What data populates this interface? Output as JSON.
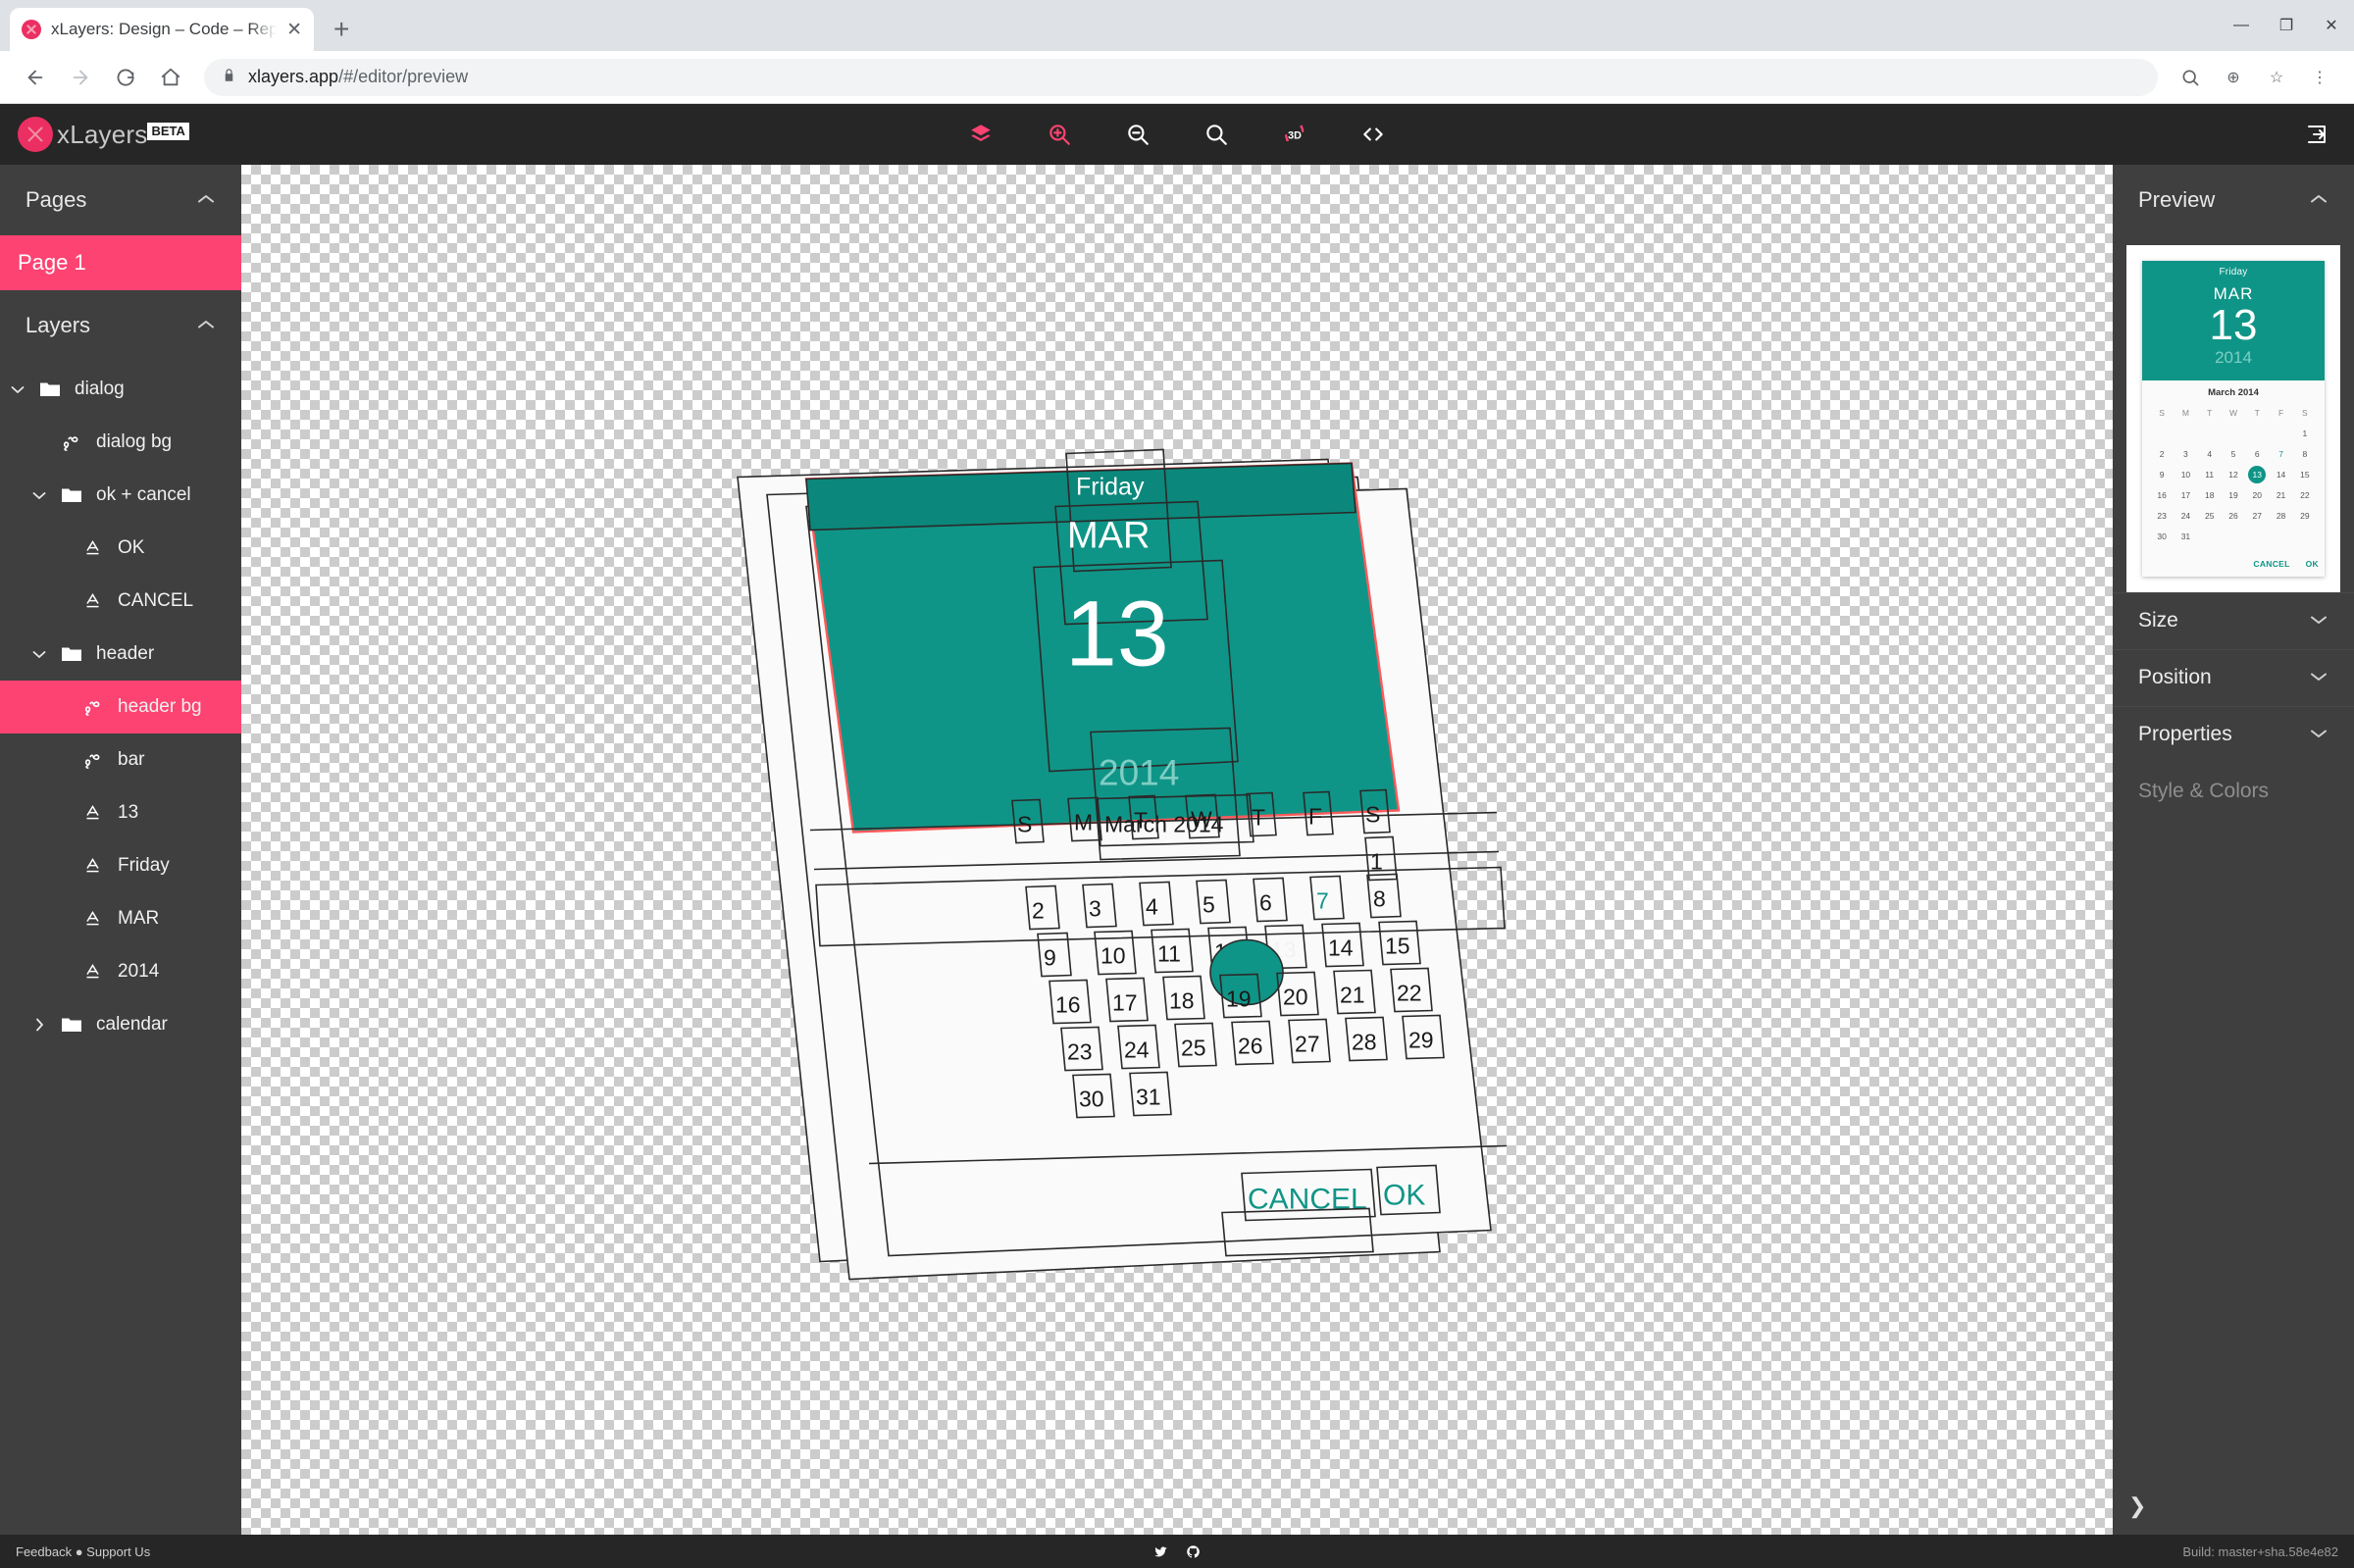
{
  "browser": {
    "tab_title": "xLayers: Design – Code – Repeat",
    "favicon": "xlayers-logo-icon",
    "new_tab_label": "+",
    "close_tab_label": "✕",
    "window_minimize": "—",
    "window_maximize": "❐",
    "window_close": "✕",
    "url_domain": "xlayers.app",
    "url_path": "/#/editor/preview",
    "back_label": "←",
    "forward_label": "→",
    "reload_label": "⟳",
    "home_label": "⌂",
    "lock_label": "🔒",
    "zoom_label": "⊕",
    "bookmark_label": "☆",
    "menu_label": "⋮"
  },
  "app_header": {
    "brand_name": "xLayers",
    "beta_badge": "BETA",
    "tools": [
      {
        "name": "layers-icon",
        "accent": true
      },
      {
        "name": "zoom-in-icon",
        "accent": true
      },
      {
        "name": "zoom-out-icon",
        "accent": false
      },
      {
        "name": "zoom-reset-icon",
        "accent": false
      },
      {
        "name": "rotate-3d-icon",
        "accent": true
      },
      {
        "name": "code-icon",
        "accent": false
      }
    ],
    "login_icon": "login-icon"
  },
  "sidebar": {
    "pages_title": "Pages",
    "pages_collapse": "⌃",
    "pages": [
      {
        "label": "Page 1",
        "selected": true
      }
    ],
    "layers_title": "Layers",
    "layers_collapse": "⌃",
    "layers": [
      {
        "label": "dialog",
        "icon": "folder-icon",
        "indent": 0,
        "arrow": "expanded",
        "selected": false
      },
      {
        "label": "dialog bg",
        "icon": "shape-icon",
        "indent": 1,
        "arrow": "none",
        "selected": false
      },
      {
        "label": "ok + cancel",
        "icon": "folder-icon",
        "indent": 1,
        "arrow": "expanded",
        "selected": false
      },
      {
        "label": "OK",
        "icon": "text-icon",
        "indent": 2,
        "arrow": "none",
        "selected": false
      },
      {
        "label": "CANCEL",
        "icon": "text-icon",
        "indent": 2,
        "arrow": "none",
        "selected": false
      },
      {
        "label": "header",
        "icon": "folder-icon",
        "indent": 1,
        "arrow": "expanded",
        "selected": false
      },
      {
        "label": "header bg",
        "icon": "shape-icon",
        "indent": 2,
        "arrow": "none",
        "selected": true
      },
      {
        "label": "bar",
        "icon": "shape-icon",
        "indent": 2,
        "arrow": "none",
        "selected": false
      },
      {
        "label": "13",
        "icon": "text-icon",
        "indent": 2,
        "arrow": "none",
        "selected": false
      },
      {
        "label": "Friday",
        "icon": "text-icon",
        "indent": 2,
        "arrow": "none",
        "selected": false
      },
      {
        "label": "MAR",
        "icon": "text-icon",
        "indent": 2,
        "arrow": "none",
        "selected": false
      },
      {
        "label": "2014",
        "icon": "text-icon",
        "indent": 2,
        "arrow": "none",
        "selected": false
      },
      {
        "label": "calendar",
        "icon": "folder-icon",
        "indent": 1,
        "arrow": "collapsed",
        "selected": false
      }
    ]
  },
  "canvas": {
    "mode": "3d-exploded-preview",
    "artboard": {
      "header_weekday": "Friday",
      "header_month": "MAR",
      "header_day": "13",
      "header_year": "2014",
      "calendar_title": "March 2014",
      "weekday_initials": [
        "S",
        "M",
        "T",
        "W",
        "T",
        "F",
        "S"
      ],
      "days": [
        1,
        2,
        3,
        4,
        5,
        6,
        7,
        8,
        9,
        10,
        11,
        12,
        13,
        14,
        15,
        16,
        17,
        18,
        19,
        20,
        21,
        22,
        23,
        24,
        25,
        26,
        27,
        28,
        29,
        30,
        31
      ],
      "accent_day": 7,
      "selected_day": 13,
      "cancel_label": "CANCEL",
      "ok_label": "OK"
    },
    "colors": {
      "teal": "#0f9587",
      "teal_dark": "#0b887b",
      "selection_outline": "#ff5a5a",
      "wireframe": "#2a2a2a",
      "sheet": "#fafafa"
    }
  },
  "right_panel": {
    "preview_title": "Preview",
    "preview_collapse": "⌃",
    "preview": {
      "weekday": "Friday",
      "month": "MAR",
      "day": "13",
      "year": "2014",
      "calendar_title": "March 2014",
      "weekday_initials": [
        "S",
        "M",
        "T",
        "W",
        "T",
        "F",
        "S"
      ],
      "leading_blanks": 6,
      "days": [
        1,
        2,
        3,
        4,
        5,
        6,
        7,
        8,
        9,
        10,
        11,
        12,
        13,
        14,
        15,
        16,
        17,
        18,
        19,
        20,
        21,
        22,
        23,
        24,
        25,
        26,
        27,
        28,
        29,
        30,
        31
      ],
      "accent_day": 7,
      "selected_day": 13,
      "cancel_label": "CANCEL",
      "ok_label": "OK"
    },
    "sections": [
      {
        "label": "Size",
        "chevron": "⌄",
        "disabled": false
      },
      {
        "label": "Position",
        "chevron": "⌄",
        "disabled": false
      },
      {
        "label": "Properties",
        "chevron": "⌄",
        "disabled": false
      },
      {
        "label": "Style & Colors",
        "chevron": "",
        "disabled": true
      }
    ],
    "collapse_handle": "❯"
  },
  "footer": {
    "feedback": "Feedback ● Support Us",
    "twitter_icon": "twitter-icon",
    "github_icon": "github-icon",
    "build": "Build: master+sha.58e4e82"
  }
}
